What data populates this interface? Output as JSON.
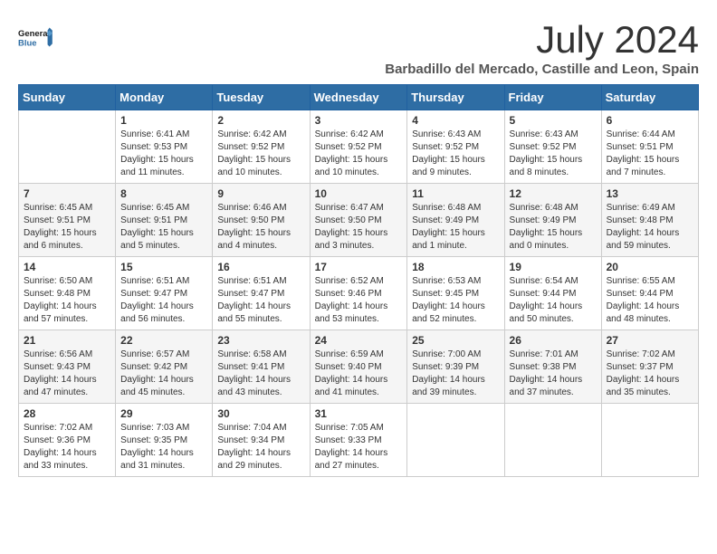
{
  "logo": {
    "line1": "General",
    "line2": "Blue"
  },
  "title": "July 2024",
  "location": "Barbadillo del Mercado, Castille and Leon, Spain",
  "headers": [
    "Sunday",
    "Monday",
    "Tuesday",
    "Wednesday",
    "Thursday",
    "Friday",
    "Saturday"
  ],
  "weeks": [
    [
      {
        "day": "",
        "content": ""
      },
      {
        "day": "1",
        "content": "Sunrise: 6:41 AM\nSunset: 9:53 PM\nDaylight: 15 hours\nand 11 minutes."
      },
      {
        "day": "2",
        "content": "Sunrise: 6:42 AM\nSunset: 9:52 PM\nDaylight: 15 hours\nand 10 minutes."
      },
      {
        "day": "3",
        "content": "Sunrise: 6:42 AM\nSunset: 9:52 PM\nDaylight: 15 hours\nand 10 minutes."
      },
      {
        "day": "4",
        "content": "Sunrise: 6:43 AM\nSunset: 9:52 PM\nDaylight: 15 hours\nand 9 minutes."
      },
      {
        "day": "5",
        "content": "Sunrise: 6:43 AM\nSunset: 9:52 PM\nDaylight: 15 hours\nand 8 minutes."
      },
      {
        "day": "6",
        "content": "Sunrise: 6:44 AM\nSunset: 9:51 PM\nDaylight: 15 hours\nand 7 minutes."
      }
    ],
    [
      {
        "day": "7",
        "content": "Sunrise: 6:45 AM\nSunset: 9:51 PM\nDaylight: 15 hours\nand 6 minutes."
      },
      {
        "day": "8",
        "content": "Sunrise: 6:45 AM\nSunset: 9:51 PM\nDaylight: 15 hours\nand 5 minutes."
      },
      {
        "day": "9",
        "content": "Sunrise: 6:46 AM\nSunset: 9:50 PM\nDaylight: 15 hours\nand 4 minutes."
      },
      {
        "day": "10",
        "content": "Sunrise: 6:47 AM\nSunset: 9:50 PM\nDaylight: 15 hours\nand 3 minutes."
      },
      {
        "day": "11",
        "content": "Sunrise: 6:48 AM\nSunset: 9:49 PM\nDaylight: 15 hours\nand 1 minute."
      },
      {
        "day": "12",
        "content": "Sunrise: 6:48 AM\nSunset: 9:49 PM\nDaylight: 15 hours\nand 0 minutes."
      },
      {
        "day": "13",
        "content": "Sunrise: 6:49 AM\nSunset: 9:48 PM\nDaylight: 14 hours\nand 59 minutes."
      }
    ],
    [
      {
        "day": "14",
        "content": "Sunrise: 6:50 AM\nSunset: 9:48 PM\nDaylight: 14 hours\nand 57 minutes."
      },
      {
        "day": "15",
        "content": "Sunrise: 6:51 AM\nSunset: 9:47 PM\nDaylight: 14 hours\nand 56 minutes."
      },
      {
        "day": "16",
        "content": "Sunrise: 6:51 AM\nSunset: 9:47 PM\nDaylight: 14 hours\nand 55 minutes."
      },
      {
        "day": "17",
        "content": "Sunrise: 6:52 AM\nSunset: 9:46 PM\nDaylight: 14 hours\nand 53 minutes."
      },
      {
        "day": "18",
        "content": "Sunrise: 6:53 AM\nSunset: 9:45 PM\nDaylight: 14 hours\nand 52 minutes."
      },
      {
        "day": "19",
        "content": "Sunrise: 6:54 AM\nSunset: 9:44 PM\nDaylight: 14 hours\nand 50 minutes."
      },
      {
        "day": "20",
        "content": "Sunrise: 6:55 AM\nSunset: 9:44 PM\nDaylight: 14 hours\nand 48 minutes."
      }
    ],
    [
      {
        "day": "21",
        "content": "Sunrise: 6:56 AM\nSunset: 9:43 PM\nDaylight: 14 hours\nand 47 minutes."
      },
      {
        "day": "22",
        "content": "Sunrise: 6:57 AM\nSunset: 9:42 PM\nDaylight: 14 hours\nand 45 minutes."
      },
      {
        "day": "23",
        "content": "Sunrise: 6:58 AM\nSunset: 9:41 PM\nDaylight: 14 hours\nand 43 minutes."
      },
      {
        "day": "24",
        "content": "Sunrise: 6:59 AM\nSunset: 9:40 PM\nDaylight: 14 hours\nand 41 minutes."
      },
      {
        "day": "25",
        "content": "Sunrise: 7:00 AM\nSunset: 9:39 PM\nDaylight: 14 hours\nand 39 minutes."
      },
      {
        "day": "26",
        "content": "Sunrise: 7:01 AM\nSunset: 9:38 PM\nDaylight: 14 hours\nand 37 minutes."
      },
      {
        "day": "27",
        "content": "Sunrise: 7:02 AM\nSunset: 9:37 PM\nDaylight: 14 hours\nand 35 minutes."
      }
    ],
    [
      {
        "day": "28",
        "content": "Sunrise: 7:02 AM\nSunset: 9:36 PM\nDaylight: 14 hours\nand 33 minutes."
      },
      {
        "day": "29",
        "content": "Sunrise: 7:03 AM\nSunset: 9:35 PM\nDaylight: 14 hours\nand 31 minutes."
      },
      {
        "day": "30",
        "content": "Sunrise: 7:04 AM\nSunset: 9:34 PM\nDaylight: 14 hours\nand 29 minutes."
      },
      {
        "day": "31",
        "content": "Sunrise: 7:05 AM\nSunset: 9:33 PM\nDaylight: 14 hours\nand 27 minutes."
      },
      {
        "day": "",
        "content": ""
      },
      {
        "day": "",
        "content": ""
      },
      {
        "day": "",
        "content": ""
      }
    ]
  ]
}
